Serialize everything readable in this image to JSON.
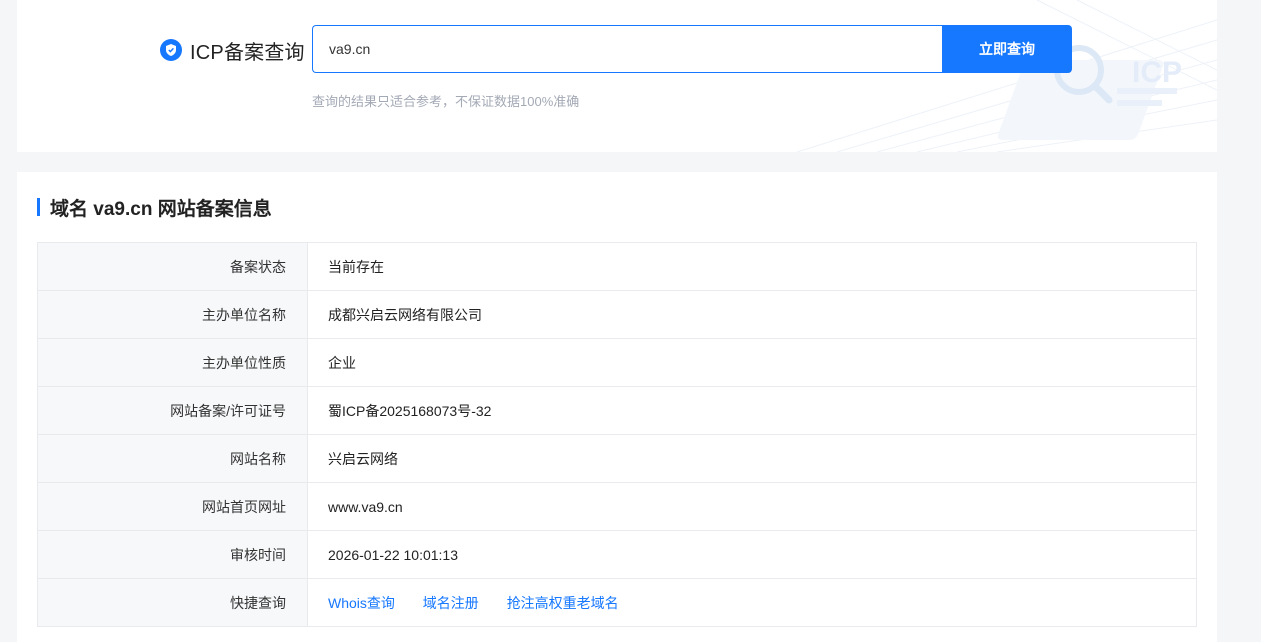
{
  "search": {
    "brand_title": "ICP备案查询",
    "query_value": "va9.cn",
    "button_label": "立即查询",
    "disclaimer": "查询的结果只适合参考，不保证数据100%准确",
    "decoration_text": "ICP",
    "icon": "shield-icon"
  },
  "section": {
    "title": "域名 va9.cn 网站备案信息"
  },
  "rows": [
    {
      "label": "备案状态",
      "value": "当前存在"
    },
    {
      "label": "主办单位名称",
      "value": "成都兴启云网络有限公司"
    },
    {
      "label": "主办单位性质",
      "value": "企业"
    },
    {
      "label": "网站备案/许可证号",
      "value": "蜀ICP备2025168073号-32"
    },
    {
      "label": "网站名称",
      "value": "兴启云网络"
    },
    {
      "label": "网站首页网址",
      "value": "www.va9.cn"
    },
    {
      "label": "审核时间",
      "value": "2026-01-22 10:01:13"
    }
  ],
  "quick": {
    "label": "快捷查询",
    "links": [
      "Whois查询",
      "域名注册",
      "抢注高权重老域名"
    ]
  },
  "colors": {
    "accent": "#1677ff",
    "page_background": "#f5f6f8",
    "label_background": "#f7f8fa",
    "muted_text": "#a3a9b5"
  }
}
